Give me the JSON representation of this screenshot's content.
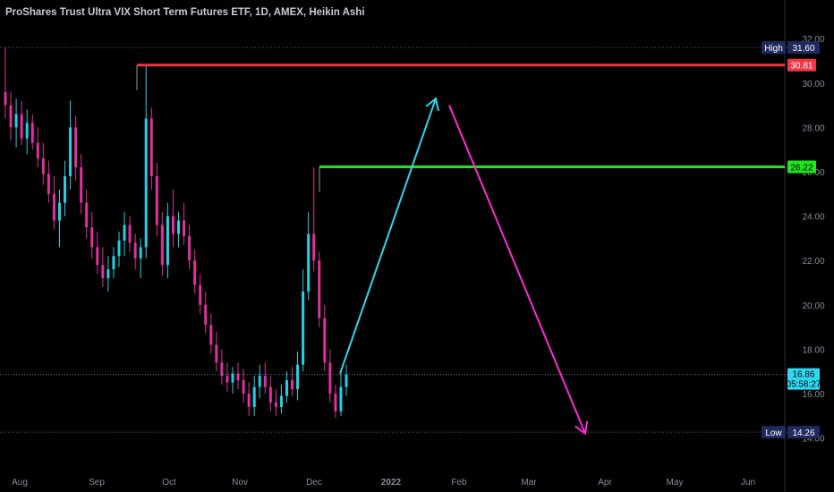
{
  "title": "ProShares Trust Ultra VIX Short Term Futures ETF, 1D, AMEX, Heikin Ashi",
  "chart_data": {
    "type": "candlestick",
    "style": "Heikin Ashi",
    "y_ticks": [
      "14.00",
      "16.00",
      "18.00",
      "20.00",
      "22.00",
      "24.00",
      "26.00",
      "28.00",
      "30.00",
      "32.00"
    ],
    "x_ticks": [
      "Aug",
      "Sep",
      "Oct",
      "Nov",
      "Dec",
      "2022",
      "Feb",
      "Mar",
      "Apr",
      "May",
      "Jun"
    ],
    "ylim": [
      13.8,
      32.2
    ],
    "colors": {
      "up": "#22d1e6",
      "down": "#e0319c",
      "background": "#000000"
    },
    "price_tags": {
      "high": {
        "label": "High",
        "value": "31.60"
      },
      "low": {
        "label": "Low",
        "value": "14.26"
      },
      "last": {
        "value": "16.86",
        "countdown": "05:58:27"
      }
    },
    "levels": [
      {
        "value": 30.81,
        "label": "30.81",
        "color": "#f23645"
      },
      {
        "value": 26.22,
        "label": "26.22",
        "color": "#1ee61e"
      }
    ],
    "projection": [
      {
        "from": 16.9,
        "to": 29.3,
        "color": "#2ed8ee"
      },
      {
        "from": 29.0,
        "to": 14.2,
        "color": "#ff2ad4"
      }
    ],
    "candle_ohlc": [
      [
        29.6,
        31.6,
        28.4,
        29.0
      ],
      [
        29.0,
        29.6,
        27.4,
        28.0
      ],
      [
        28.0,
        29.3,
        27.1,
        28.6
      ],
      [
        28.6,
        29.2,
        27.2,
        27.5
      ],
      [
        27.5,
        28.8,
        26.8,
        28.2
      ],
      [
        28.2,
        28.6,
        27.0,
        27.3
      ],
      [
        27.3,
        28.0,
        26.2,
        26.6
      ],
      [
        26.6,
        27.3,
        25.4,
        25.9
      ],
      [
        25.9,
        26.5,
        24.6,
        25.0
      ],
      [
        25.0,
        25.8,
        23.4,
        23.8
      ],
      [
        23.8,
        25.2,
        22.6,
        24.6
      ],
      [
        24.6,
        26.5,
        24.0,
        25.8
      ],
      [
        25.8,
        29.2,
        25.2,
        28.0
      ],
      [
        28.0,
        28.5,
        25.6,
        26.2
      ],
      [
        26.2,
        26.8,
        24.1,
        24.6
      ],
      [
        24.6,
        25.2,
        23.0,
        23.5
      ],
      [
        23.5,
        24.2,
        22.1,
        22.6
      ],
      [
        22.6,
        23.3,
        21.4,
        21.8
      ],
      [
        21.8,
        22.6,
        20.8,
        21.2
      ],
      [
        21.2,
        22.2,
        20.6,
        21.6
      ],
      [
        21.6,
        22.6,
        21.2,
        22.2
      ],
      [
        22.2,
        23.3,
        21.7,
        22.9
      ],
      [
        22.9,
        24.2,
        22.2,
        23.6
      ],
      [
        23.6,
        24.0,
        22.4,
        22.8
      ],
      [
        22.8,
        23.2,
        21.6,
        22.1
      ],
      [
        22.1,
        23.0,
        21.2,
        22.6
      ],
      [
        22.6,
        30.8,
        22.1,
        28.4
      ],
      [
        28.4,
        28.9,
        25.2,
        25.8
      ],
      [
        25.8,
        26.4,
        23.1,
        23.6
      ],
      [
        23.6,
        24.2,
        21.3,
        21.8
      ],
      [
        21.8,
        24.6,
        21.2,
        24.0
      ],
      [
        24.0,
        25.2,
        22.6,
        23.2
      ],
      [
        23.2,
        24.2,
        22.6,
        23.8
      ],
      [
        23.8,
        24.6,
        22.7,
        23.1
      ],
      [
        23.1,
        23.6,
        21.6,
        22.0
      ],
      [
        22.0,
        22.5,
        20.5,
        20.9
      ],
      [
        20.9,
        21.4,
        19.6,
        20.0
      ],
      [
        20.0,
        20.6,
        18.7,
        19.1
      ],
      [
        19.1,
        19.6,
        17.8,
        18.2
      ],
      [
        18.2,
        18.8,
        17.0,
        17.4
      ],
      [
        17.4,
        18.0,
        16.4,
        16.8
      ],
      [
        16.8,
        17.4,
        16.1,
        16.5
      ],
      [
        16.5,
        17.2,
        16.0,
        16.9
      ],
      [
        16.9,
        17.4,
        16.2,
        16.6
      ],
      [
        16.6,
        17.1,
        15.6,
        16.0
      ],
      [
        16.0,
        16.5,
        15.0,
        15.4
      ],
      [
        15.4,
        16.8,
        15.0,
        16.3
      ],
      [
        16.3,
        17.3,
        15.8,
        16.8
      ],
      [
        16.8,
        17.4,
        16.0,
        16.3
      ],
      [
        16.3,
        16.8,
        15.2,
        15.6
      ],
      [
        15.6,
        16.2,
        15.0,
        15.4
      ],
      [
        15.4,
        16.4,
        15.1,
        15.9
      ],
      [
        15.9,
        17.0,
        15.6,
        16.6
      ],
      [
        16.6,
        17.2,
        15.9,
        16.2
      ],
      [
        16.2,
        17.9,
        15.7,
        17.3
      ],
      [
        17.3,
        21.6,
        17.0,
        20.6
      ],
      [
        20.6,
        24.2,
        20.2,
        23.2
      ],
      [
        23.2,
        26.2,
        21.5,
        22.0
      ],
      [
        22.0,
        22.4,
        19.0,
        19.4
      ],
      [
        19.4,
        20.0,
        17.0,
        17.4
      ],
      [
        17.4,
        18.0,
        15.6,
        16.0
      ],
      [
        16.0,
        16.4,
        14.9,
        15.2
      ],
      [
        15.2,
        17.1,
        15.0,
        16.3
      ],
      [
        16.3,
        17.3,
        15.9,
        16.86
      ]
    ]
  }
}
